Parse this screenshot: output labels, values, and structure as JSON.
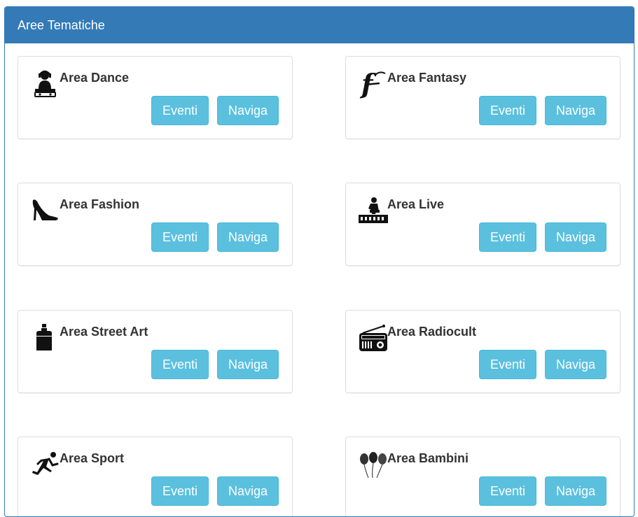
{
  "panel": {
    "title": "Aree Tematiche"
  },
  "buttons": {
    "eventi": "Eventi",
    "naviga": "Naviga"
  },
  "areas": [
    {
      "title": "Area Dance",
      "icon": "dj-icon"
    },
    {
      "title": "Area Fantasy",
      "icon": "gothic-letter-f-icon"
    },
    {
      "title": "Area Fashion",
      "icon": "high-heel-icon"
    },
    {
      "title": "Area Live",
      "icon": "pianist-icon"
    },
    {
      "title": "Area Street Art",
      "icon": "spray-can-icon"
    },
    {
      "title": "Area Radiocult",
      "icon": "radio-icon"
    },
    {
      "title": "Area Sport",
      "icon": "runner-icon"
    },
    {
      "title": "Area Bambini",
      "icon": "balloons-icon"
    }
  ]
}
